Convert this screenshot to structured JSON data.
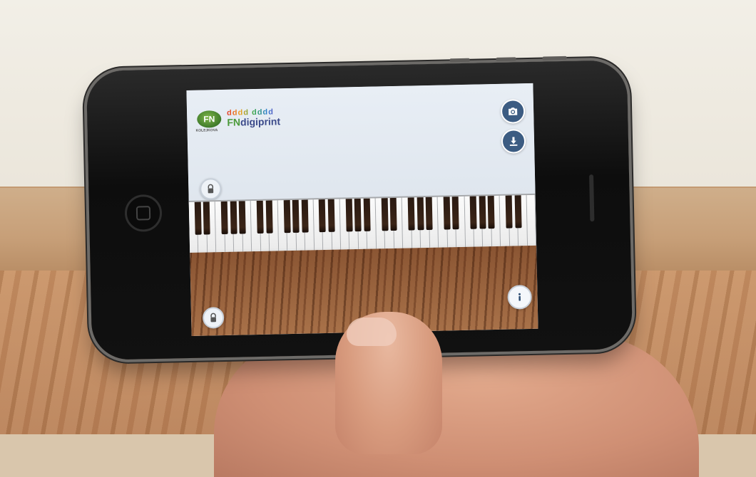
{
  "scene": {
    "wall_color": "#efebe2",
    "floor_color": "#c08a60"
  },
  "app": {
    "logo": {
      "mark_text": "FN",
      "mark_caption": "KOLEJKOVA",
      "tagline": "dddd dddd",
      "brand_prefix": "FN",
      "brand_name": "digiprint"
    },
    "buttons": {
      "camera_icon": "camera-icon",
      "download_icon": "download-icon",
      "info_icon": "info-icon",
      "lock_icon": "lock-icon"
    },
    "accent_color": "#3c5c82",
    "keyboard": {
      "white_keys": 39
    }
  }
}
